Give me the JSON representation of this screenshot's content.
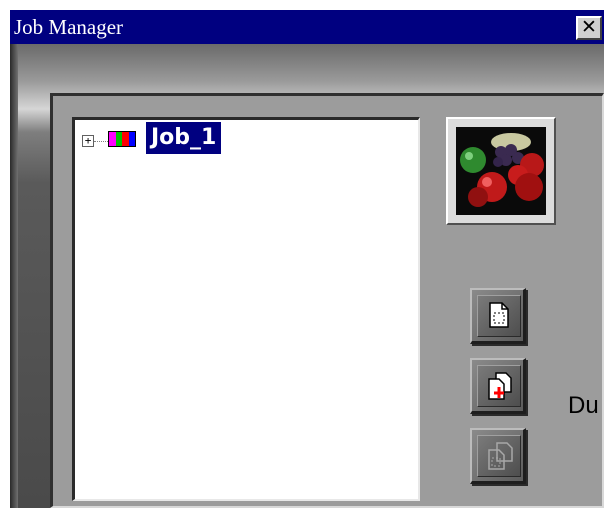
{
  "window": {
    "title": "Job Manager",
    "close_label": "✕"
  },
  "tree": {
    "items": [
      {
        "label": "Job_1",
        "expander": "+",
        "icon": "color-bars-icon",
        "selected": true
      }
    ]
  },
  "thumbnail": {
    "subject": "fruit photo"
  },
  "side_buttons": [
    {
      "icon": "new-page-icon",
      "enabled": true
    },
    {
      "icon": "add-page-icon",
      "enabled": true
    },
    {
      "icon": "copy-page-icon",
      "enabled": false
    }
  ],
  "overflow_text": "Du",
  "colors": {
    "title_bar": "#000080",
    "selection": "#000080",
    "icon_bars": [
      "#ff00ff",
      "#00c000",
      "#ff0000",
      "#0000ff"
    ]
  }
}
